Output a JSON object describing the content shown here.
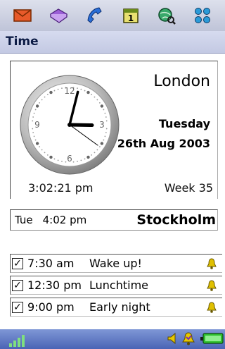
{
  "toolbar": {
    "icons": [
      "mail-icon",
      "diary-book-icon",
      "phone-icon",
      "calendar-icon",
      "web-globe-icon",
      "apps-grid-icon"
    ],
    "calendar_day": "1"
  },
  "titlebar": {
    "title": "Time"
  },
  "clock": {
    "city": "London",
    "weekday": "Tuesday",
    "date": "26th Aug 2003",
    "local_time": "3:02:21 pm",
    "week": "Week 35",
    "face_numbers": [
      "12",
      "3",
      "6",
      "9"
    ],
    "hands": {
      "hour": 3,
      "minute": 2,
      "second": 21
    }
  },
  "world": {
    "day": "Tue",
    "time": "4:02 pm",
    "city": "Stockholm"
  },
  "alarms": [
    {
      "time": "7:30 am",
      "label": "Wake up!",
      "checked": true
    },
    {
      "time": "12:30 pm",
      "label": "Lunchtime",
      "checked": true
    },
    {
      "time": "9:00 pm",
      "label": "Early night",
      "checked": true
    }
  ],
  "colors": {
    "accent_blue": "#5a74c4",
    "alarm_bell": "#d8b800",
    "battery_green": "#2fbf2f"
  }
}
